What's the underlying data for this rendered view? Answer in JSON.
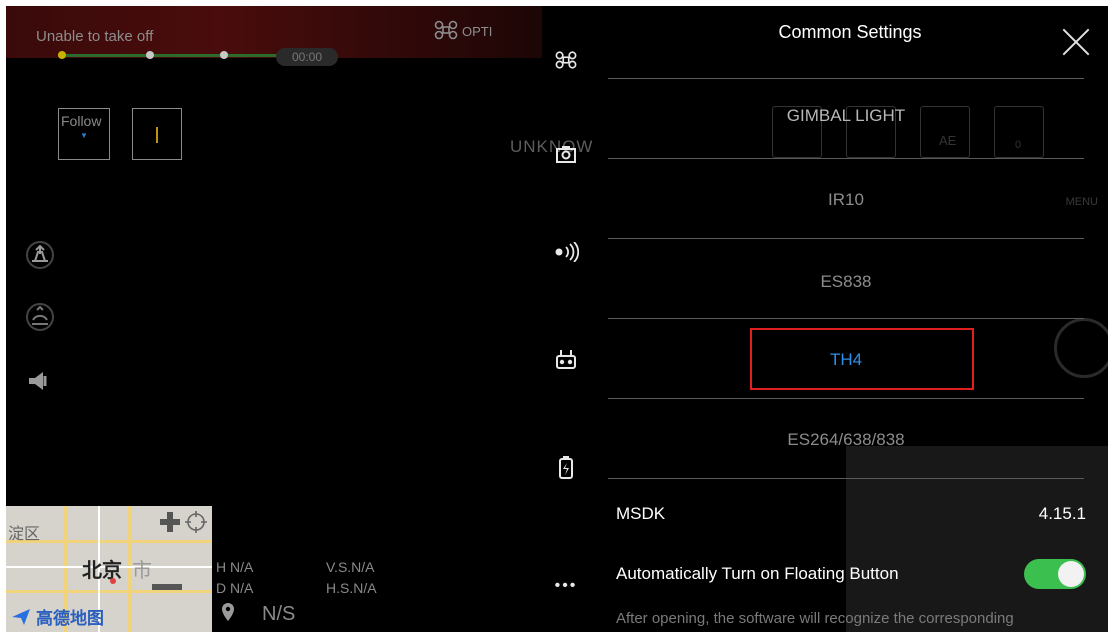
{
  "status": {
    "warning": "Unable to take off",
    "opti_label": "OPTI",
    "timer": "00:00"
  },
  "camera": {
    "follow_label": "Follow",
    "unknown_label": "UNKNOWN"
  },
  "map": {
    "district": "淀区",
    "city": "北京",
    "city_suffix": "市",
    "provider": "高德地图"
  },
  "telemetry": {
    "h": "H N/A",
    "d": "D N/A",
    "vs": "V.S.N/A",
    "hs": "H.S.N/A",
    "location": "N/S"
  },
  "rail": {
    "more": "•••"
  },
  "settings": {
    "title": "Common Settings",
    "gimbal_light": "GIMBAL LIGHT",
    "ae_label": "AE",
    "ghost_zero": "0",
    "menu_label": "MENU",
    "options": [
      "IR10",
      "ES838",
      "TH4",
      "ES264/638/838"
    ],
    "selected_option": "TH4",
    "msdk_label": "MSDK",
    "msdk_value": "4.15.1",
    "floating_label": "Automatically Turn on Floating Button",
    "floating_enabled": true,
    "floating_desc": "After opening, the software will recognize the corresponding"
  },
  "colors": {
    "accent_blue": "#2f8fe8",
    "toggle_green": "#3bbf4e",
    "highlight_red": "#e02020"
  }
}
